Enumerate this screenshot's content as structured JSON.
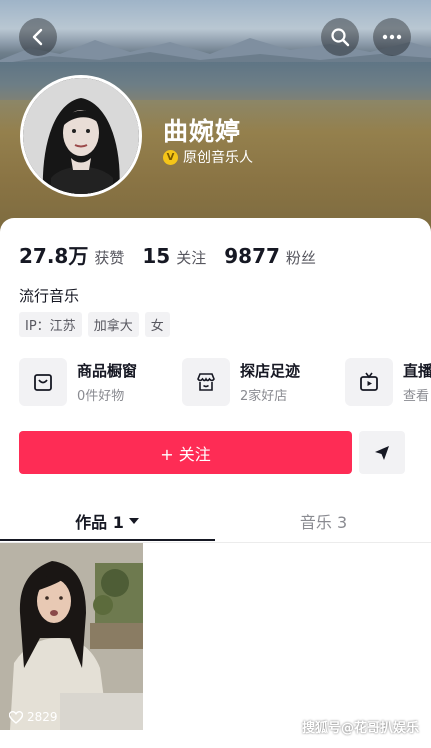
{
  "header": {
    "back_icon": "chevron-left-icon",
    "search_icon": "search-icon",
    "more_icon": "more-dots-icon"
  },
  "profile": {
    "name": "曲婉婷",
    "verified_badge": "V",
    "verified_label": "原创音乐人"
  },
  "stats": [
    {
      "value": "27.8万",
      "label": "获赞"
    },
    {
      "value": "15",
      "label": "关注"
    },
    {
      "value": "9877",
      "label": "粉丝"
    }
  ],
  "bio": "流行音乐",
  "tags": [
    "IP：江苏",
    "加拿大",
    "女"
  ],
  "features": [
    {
      "title": "商品橱窗",
      "subtitle": "0件好物",
      "icon": "shop-bag-icon"
    },
    {
      "title": "探店足迹",
      "subtitle": "2家好店",
      "icon": "store-icon"
    },
    {
      "title": "直播",
      "subtitle": "查看",
      "icon": "live-tv-icon"
    }
  ],
  "actions": {
    "follow_label": "+ 关注",
    "share_icon": "send-icon"
  },
  "tabs": [
    {
      "label": "作品 1",
      "active": true
    },
    {
      "label": "音乐 3",
      "active": false
    }
  ],
  "videos": [
    {
      "likes": "2829"
    }
  ],
  "watermark": "搜狐号@花哥扒娱乐",
  "colors": {
    "accent": "#fe2c55",
    "text": "#161823",
    "muted": "#8a8b91"
  }
}
